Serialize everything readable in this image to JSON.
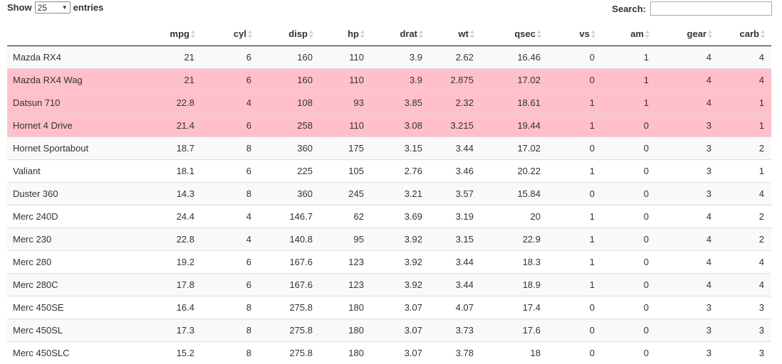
{
  "length": {
    "show_label": "Show",
    "value": "25",
    "entries_label": "entries"
  },
  "search": {
    "label": "Search:",
    "value": ""
  },
  "columns": [
    "",
    "mpg",
    "cyl",
    "disp",
    "hp",
    "drat",
    "wt",
    "qsec",
    "vs",
    "am",
    "gear",
    "carb"
  ],
  "rows": [
    {
      "cells": [
        "Mazda RX4",
        "21",
        "6",
        "160",
        "110",
        "3.9",
        "2.62",
        "16.46",
        "0",
        "1",
        "4",
        "4"
      ],
      "selected": false
    },
    {
      "cells": [
        "Mazda RX4 Wag",
        "21",
        "6",
        "160",
        "110",
        "3.9",
        "2.875",
        "17.02",
        "0",
        "1",
        "4",
        "4"
      ],
      "selected": true
    },
    {
      "cells": [
        "Datsun 710",
        "22.8",
        "4",
        "108",
        "93",
        "3.85",
        "2.32",
        "18.61",
        "1",
        "1",
        "4",
        "1"
      ],
      "selected": true
    },
    {
      "cells": [
        "Hornet 4 Drive",
        "21.4",
        "6",
        "258",
        "110",
        "3.08",
        "3.215",
        "19.44",
        "1",
        "0",
        "3",
        "1"
      ],
      "selected": true
    },
    {
      "cells": [
        "Hornet Sportabout",
        "18.7",
        "8",
        "360",
        "175",
        "3.15",
        "3.44",
        "17.02",
        "0",
        "0",
        "3",
        "2"
      ],
      "selected": false
    },
    {
      "cells": [
        "Valiant",
        "18.1",
        "6",
        "225",
        "105",
        "2.76",
        "3.46",
        "20.22",
        "1",
        "0",
        "3",
        "1"
      ],
      "selected": false
    },
    {
      "cells": [
        "Duster 360",
        "14.3",
        "8",
        "360",
        "245",
        "3.21",
        "3.57",
        "15.84",
        "0",
        "0",
        "3",
        "4"
      ],
      "selected": false
    },
    {
      "cells": [
        "Merc 240D",
        "24.4",
        "4",
        "146.7",
        "62",
        "3.69",
        "3.19",
        "20",
        "1",
        "0",
        "4",
        "2"
      ],
      "selected": false
    },
    {
      "cells": [
        "Merc 230",
        "22.8",
        "4",
        "140.8",
        "95",
        "3.92",
        "3.15",
        "22.9",
        "1",
        "0",
        "4",
        "2"
      ],
      "selected": false
    },
    {
      "cells": [
        "Merc 280",
        "19.2",
        "6",
        "167.6",
        "123",
        "3.92",
        "3.44",
        "18.3",
        "1",
        "0",
        "4",
        "4"
      ],
      "selected": false
    },
    {
      "cells": [
        "Merc 280C",
        "17.8",
        "6",
        "167.6",
        "123",
        "3.92",
        "3.44",
        "18.9",
        "1",
        "0",
        "4",
        "4"
      ],
      "selected": false
    },
    {
      "cells": [
        "Merc 450SE",
        "16.4",
        "8",
        "275.8",
        "180",
        "3.07",
        "4.07",
        "17.4",
        "0",
        "0",
        "3",
        "3"
      ],
      "selected": false
    },
    {
      "cells": [
        "Merc 450SL",
        "17.3",
        "8",
        "275.8",
        "180",
        "3.07",
        "3.73",
        "17.6",
        "0",
        "0",
        "3",
        "3"
      ],
      "selected": false
    },
    {
      "cells": [
        "Merc 450SLC",
        "15.2",
        "8",
        "275.8",
        "180",
        "3.07",
        "3.78",
        "18",
        "0",
        "0",
        "3",
        "3"
      ],
      "selected": false
    }
  ],
  "colors": {
    "selected_row": "#ffc0cb",
    "odd_row": "#f9f9f9"
  }
}
